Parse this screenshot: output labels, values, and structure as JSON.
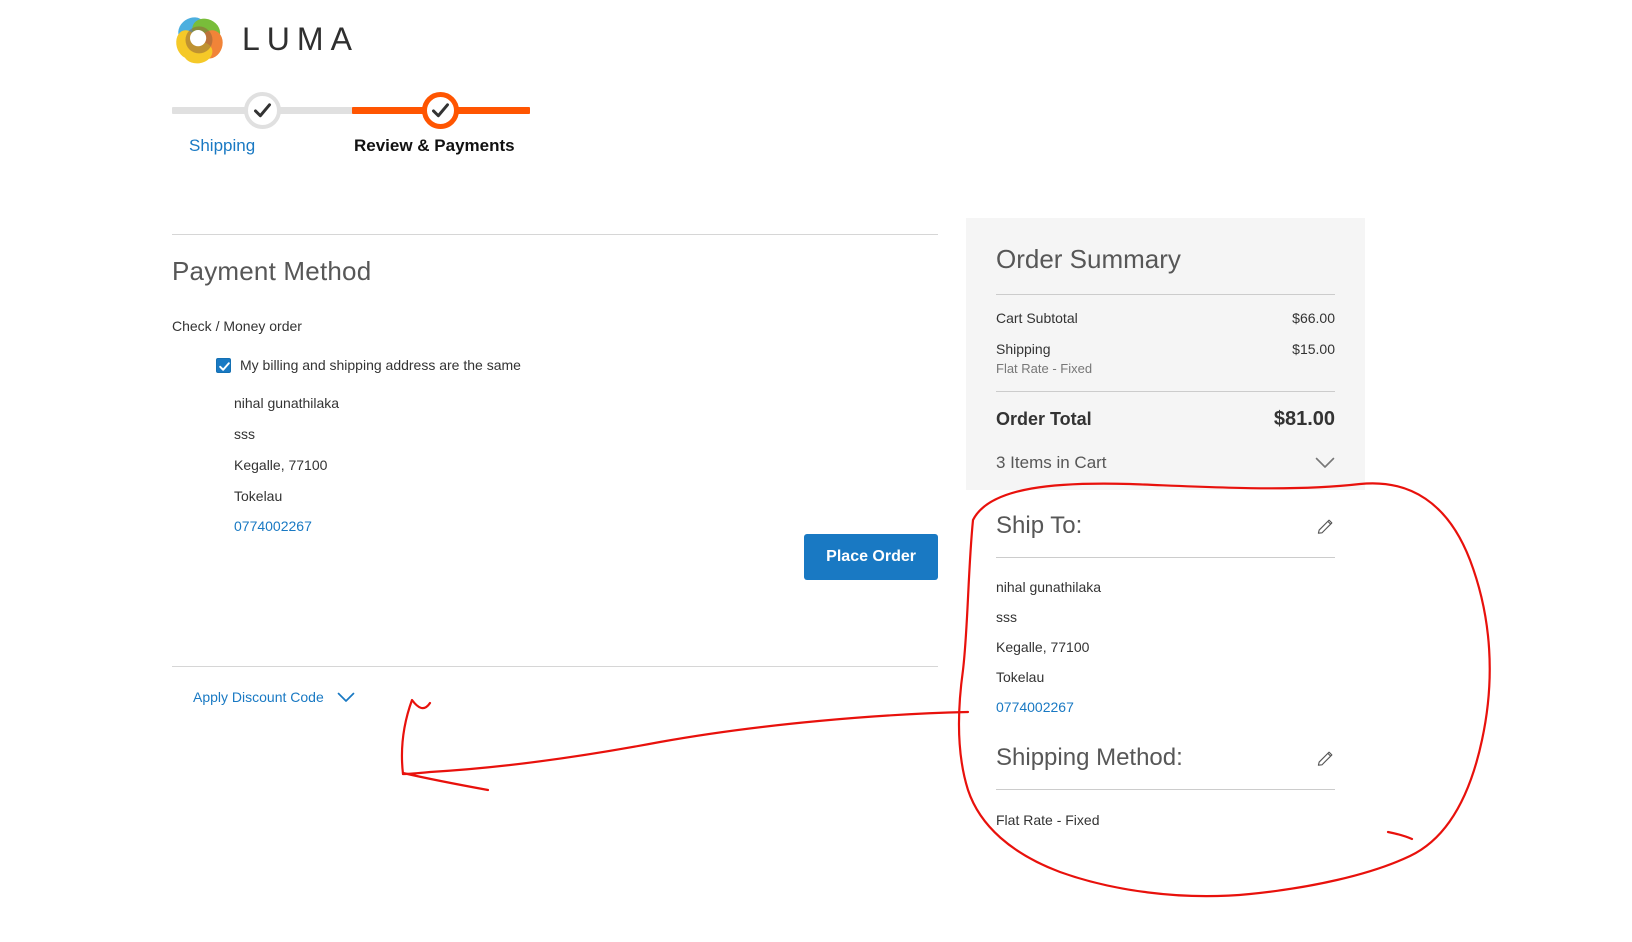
{
  "brand": {
    "name": "LUMA",
    "logo_icon": "luma-rings-logo"
  },
  "checkout_progress": {
    "steps": [
      {
        "label": "Shipping",
        "state": "completed",
        "icon": "check-icon"
      },
      {
        "label": "Review & Payments",
        "state": "active",
        "icon": "check-icon"
      }
    ]
  },
  "payment": {
    "section_title": "Payment Method",
    "method_label": "Check / Money order",
    "billing_same_checkbox": {
      "label": "My billing and shipping address are the same",
      "checked": true
    },
    "billing_address": {
      "name": "nihal gunathilaka",
      "street": "sss",
      "city_zip": "Kegalle, 77100",
      "country": "Tokelau",
      "phone": "0774002267"
    },
    "place_order_label": "Place Order",
    "discount": {
      "label": "Apply Discount Code",
      "icon": "chevron-down-icon",
      "expanded": false
    }
  },
  "order_summary": {
    "title": "Order Summary",
    "rows": [
      {
        "label": "Cart Subtotal",
        "sub": "",
        "value": "$66.00"
      },
      {
        "label": "Shipping",
        "sub": "Flat Rate - Fixed",
        "value": "$15.00"
      }
    ],
    "total": {
      "label": "Order Total",
      "value": "$81.00"
    },
    "items_toggle": {
      "label": "3 Items in Cart",
      "icon": "chevron-down-icon",
      "expanded": false
    }
  },
  "ship_to": {
    "title": "Ship To:",
    "edit_icon": "pencil-icon",
    "name": "nihal gunathilaka",
    "street": "sss",
    "city_zip": "Kegalle, 77100",
    "country": "Tokelau",
    "phone": "0774002267"
  },
  "shipping_method": {
    "title": "Shipping Method:",
    "edit_icon": "pencil-icon",
    "value": "Flat Rate - Fixed"
  },
  "annotation": {
    "type": "freehand-ink",
    "color": "#e8110c",
    "description": "hand-drawn red circle around Ship To / Shipping Method with arrow pointing left"
  }
}
